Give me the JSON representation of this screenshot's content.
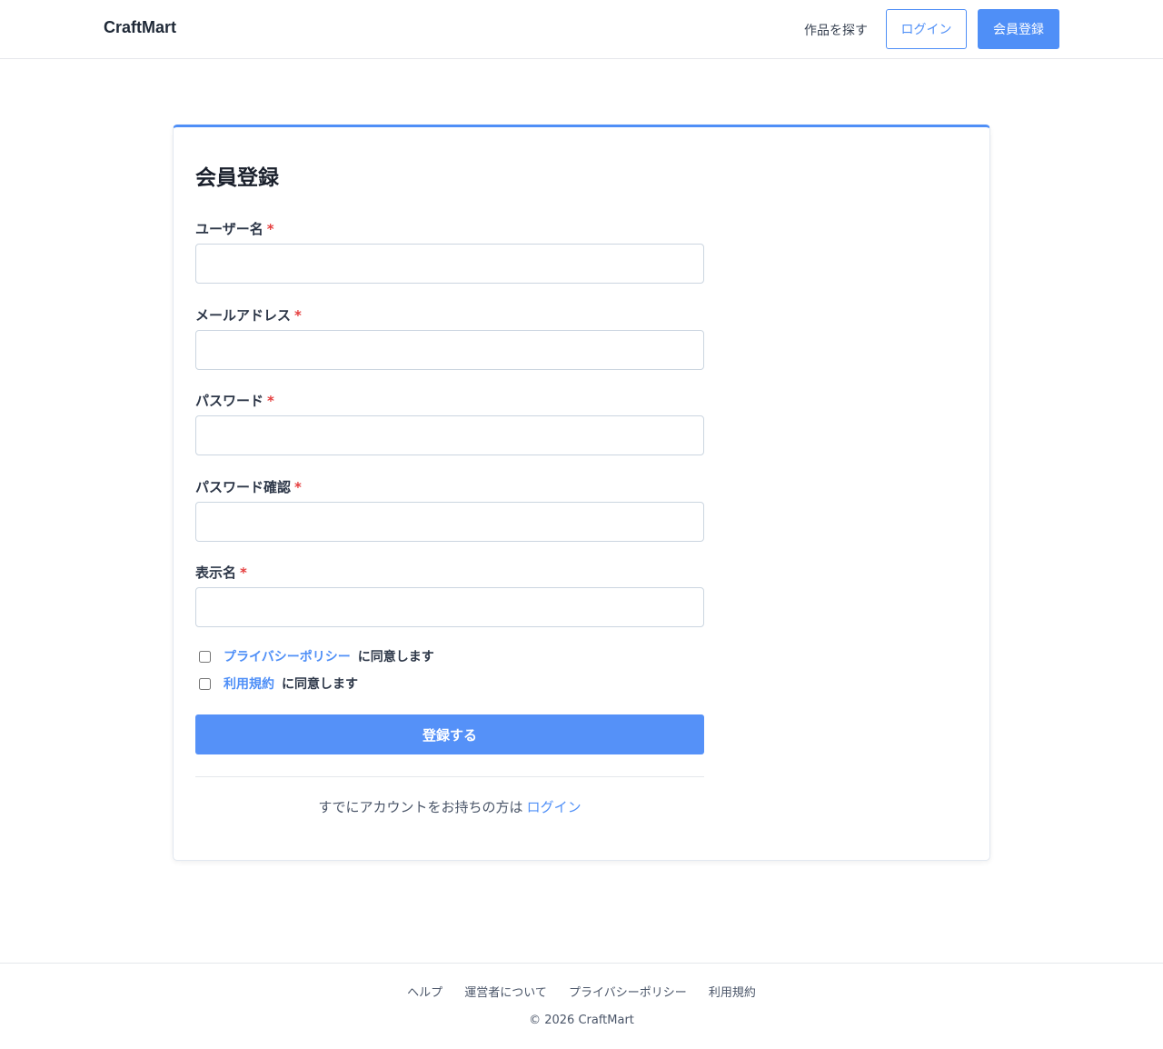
{
  "header": {
    "brand": "CraftMart",
    "browse_link": "作品を探す",
    "login_button": "ログイン",
    "register_button": "会員登録"
  },
  "form": {
    "title": "会員登録",
    "required_mark": "*",
    "fields": [
      {
        "label": "ユーザー名",
        "value": "",
        "placeholder": ""
      },
      {
        "label": "メールアドレス",
        "value": "",
        "placeholder": ""
      },
      {
        "label": "パスワード",
        "value": "",
        "placeholder": ""
      },
      {
        "label": "パスワード確認",
        "value": "",
        "placeholder": ""
      },
      {
        "label": "表示名",
        "value": "",
        "placeholder": ""
      }
    ],
    "privacy_link": "プライバシーポリシー",
    "privacy_agree": "に同意します",
    "terms_link": "利用規約",
    "terms_agree": "に同意します",
    "submit": "登録する",
    "login_prompt": "すでにアカウントをお持ちの方は",
    "login_link": "ログイン"
  },
  "footer": {
    "links": [
      "ヘルプ",
      "運営者について",
      "プライバシーポリシー",
      "利用規約"
    ],
    "copyright": "© 2026 CraftMart"
  },
  "colors": {
    "accent": "#4f8ff7",
    "required": "#e53e3e"
  }
}
